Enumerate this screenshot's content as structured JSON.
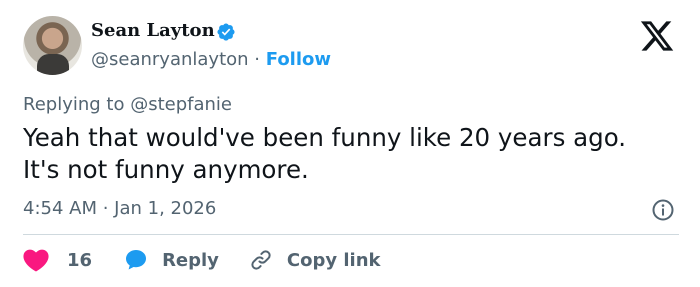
{
  "author": {
    "name": "Sean Layton",
    "handle": "@seanryanlayton",
    "separator": "·",
    "follow_label": "Follow",
    "verified": true,
    "avatar_icon": "profile-photo"
  },
  "brand": {
    "logo": "x-logo"
  },
  "tweet": {
    "replying_to": "Replying to @stepfanie",
    "lines": [
      "Yeah that would've been funny like 20 years ago.",
      "It's not funny anymore."
    ],
    "timestamp": "4:54 AM · Jan 1, 2026"
  },
  "actions": {
    "like_count": "16",
    "reply_label": "Reply",
    "copy_label": "Copy link"
  },
  "colors": {
    "accent": "#1d9bf0",
    "like": "#f91880",
    "secondary_text": "#536471",
    "text": "#0f1419"
  }
}
